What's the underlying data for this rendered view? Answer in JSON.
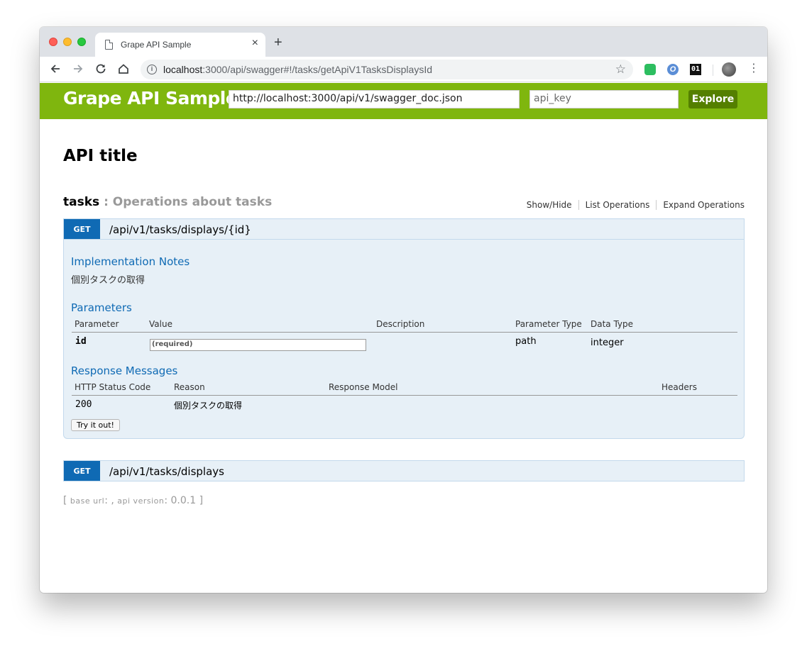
{
  "browser": {
    "tab_title": "Grape API Sample",
    "tab_close": "×",
    "new_tab": "+",
    "url_host": "localhost",
    "url_rest": ":3000/api/swagger#!/tasks/getApiV1TasksDisplaysId"
  },
  "header": {
    "logo": "Grape API Sample",
    "url_value": "http://localhost:3000/api/v1/swagger_doc.json",
    "api_key_placeholder": "api_key",
    "explore_label": "Explore"
  },
  "page": {
    "api_title": "API title",
    "resource": {
      "name": "tasks",
      "separator": " : ",
      "description": "Operations about tasks",
      "links": [
        "Show/Hide",
        "List Operations",
        "Expand Operations"
      ]
    },
    "operations": [
      {
        "method": "GET",
        "path": "/api/v1/tasks/displays/{id}",
        "implementation_notes_heading": "Implementation Notes",
        "implementation_notes": "個別タスクの取得",
        "parameters_heading": "Parameters",
        "parameter_columns": [
          "Parameter",
          "Value",
          "Description",
          "Parameter Type",
          "Data Type"
        ],
        "parameters": [
          {
            "name": "id",
            "value_placeholder": "(required)",
            "description": "",
            "parameter_type": "path",
            "data_type": "integer"
          }
        ],
        "response_heading": "Response Messages",
        "response_columns": [
          "HTTP Status Code",
          "Reason",
          "Response Model",
          "Headers"
        ],
        "responses": [
          {
            "code": "200",
            "reason": "個別タスクの取得",
            "model": "",
            "headers": ""
          }
        ],
        "try_label": "Try it out!"
      },
      {
        "method": "GET",
        "path": "/api/v1/tasks/displays"
      }
    ],
    "footer": {
      "open": "[ ",
      "base_url_label": "base url",
      "base_url_value": ": , ",
      "api_version_label": "api version",
      "api_version_value": ": 0.0.1",
      "close": " ]"
    }
  },
  "colors": {
    "header_green": "#7fb60e",
    "explore_button": "#547f00",
    "get_badge": "#0f6ab4",
    "operation_bg": "#e7f0f7"
  }
}
